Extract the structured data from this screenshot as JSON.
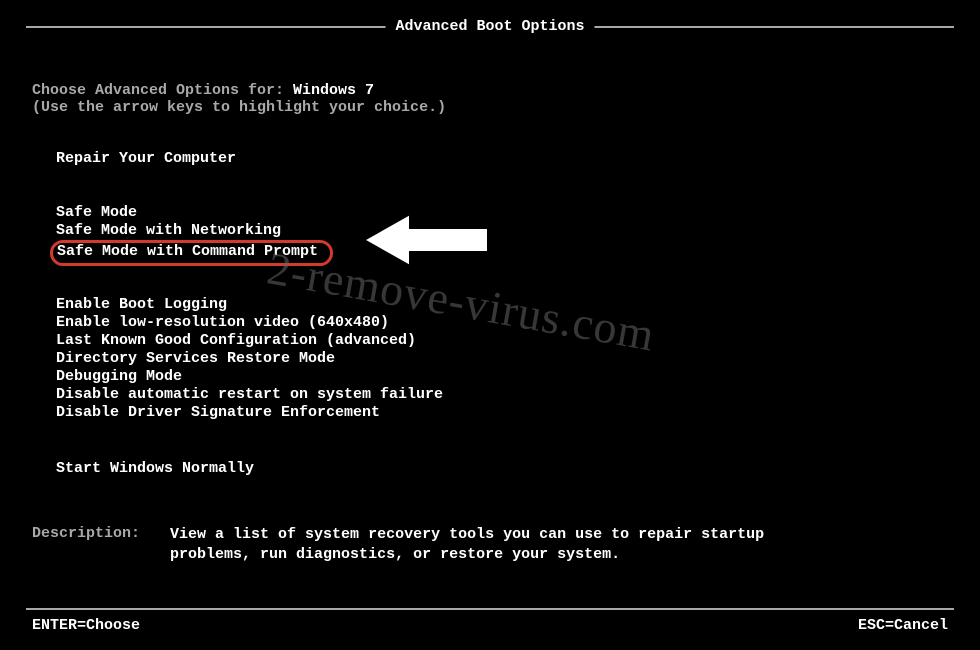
{
  "title": "Advanced Boot Options",
  "intro": {
    "prefix": "Choose Advanced Options for: ",
    "os": "Windows 7",
    "hint": "(Use the arrow keys to highlight your choice.)"
  },
  "repair": "Repair Your Computer",
  "safe_modes": [
    "Safe Mode",
    "Safe Mode with Networking",
    "Safe Mode with Command Prompt"
  ],
  "options": [
    "Enable Boot Logging",
    "Enable low-resolution video (640x480)",
    "Last Known Good Configuration (advanced)",
    "Directory Services Restore Mode",
    "Debugging Mode",
    "Disable automatic restart on system failure",
    "Disable Driver Signature Enforcement"
  ],
  "start_normal": "Start Windows Normally",
  "description": {
    "label": "Description:",
    "text": "View a list of system recovery tools you can use to repair startup problems, run diagnostics, or restore your system."
  },
  "footer": {
    "enter": "ENTER=Choose",
    "esc": "ESC=Cancel"
  },
  "watermark": "2-remove-virus.com"
}
